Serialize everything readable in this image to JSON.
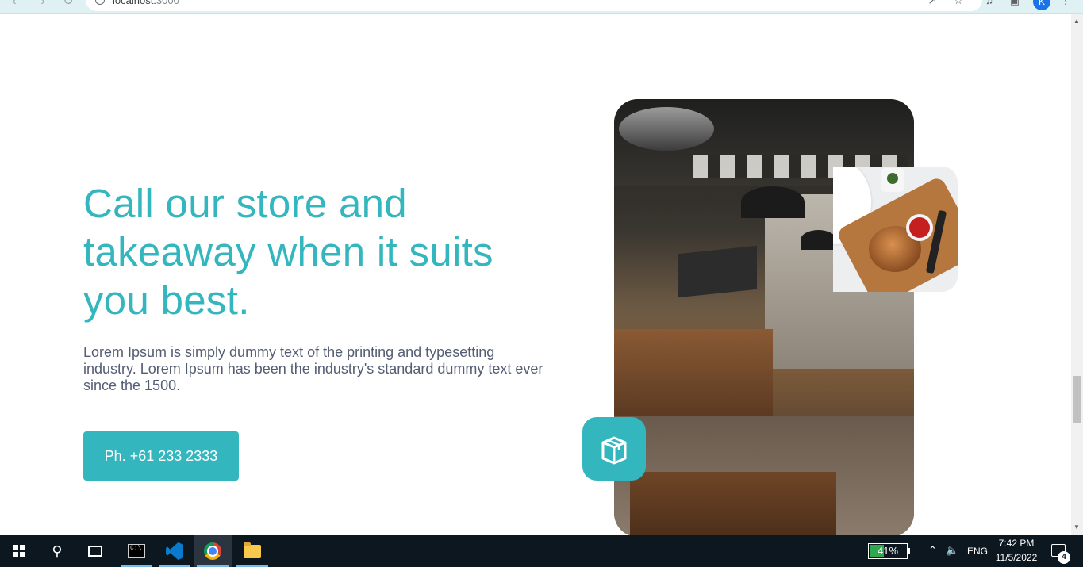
{
  "browser": {
    "url_host": "localhost:",
    "url_port": "3000",
    "profile_initial": "K"
  },
  "hero": {
    "headline": "Call our store and takeaway when it suits you best.",
    "body": "Lorem Ipsum is simply dummy text of the printing and typesetting industry. Lorem Ipsum has been the industry's standard dummy text ever since the 1500.",
    "phone_button": "Ph. +61 233 2333"
  },
  "colors": {
    "accent": "#34b6be",
    "body_text": "#555d73",
    "taskbar": "#0d1720"
  },
  "icons": {
    "badge": "delivery-box-icon"
  },
  "taskbar": {
    "battery_percent": 41,
    "battery_label": "41%",
    "language": "ENG",
    "time": "7:42 PM",
    "date": "11/5/2022",
    "notifications": "4"
  }
}
